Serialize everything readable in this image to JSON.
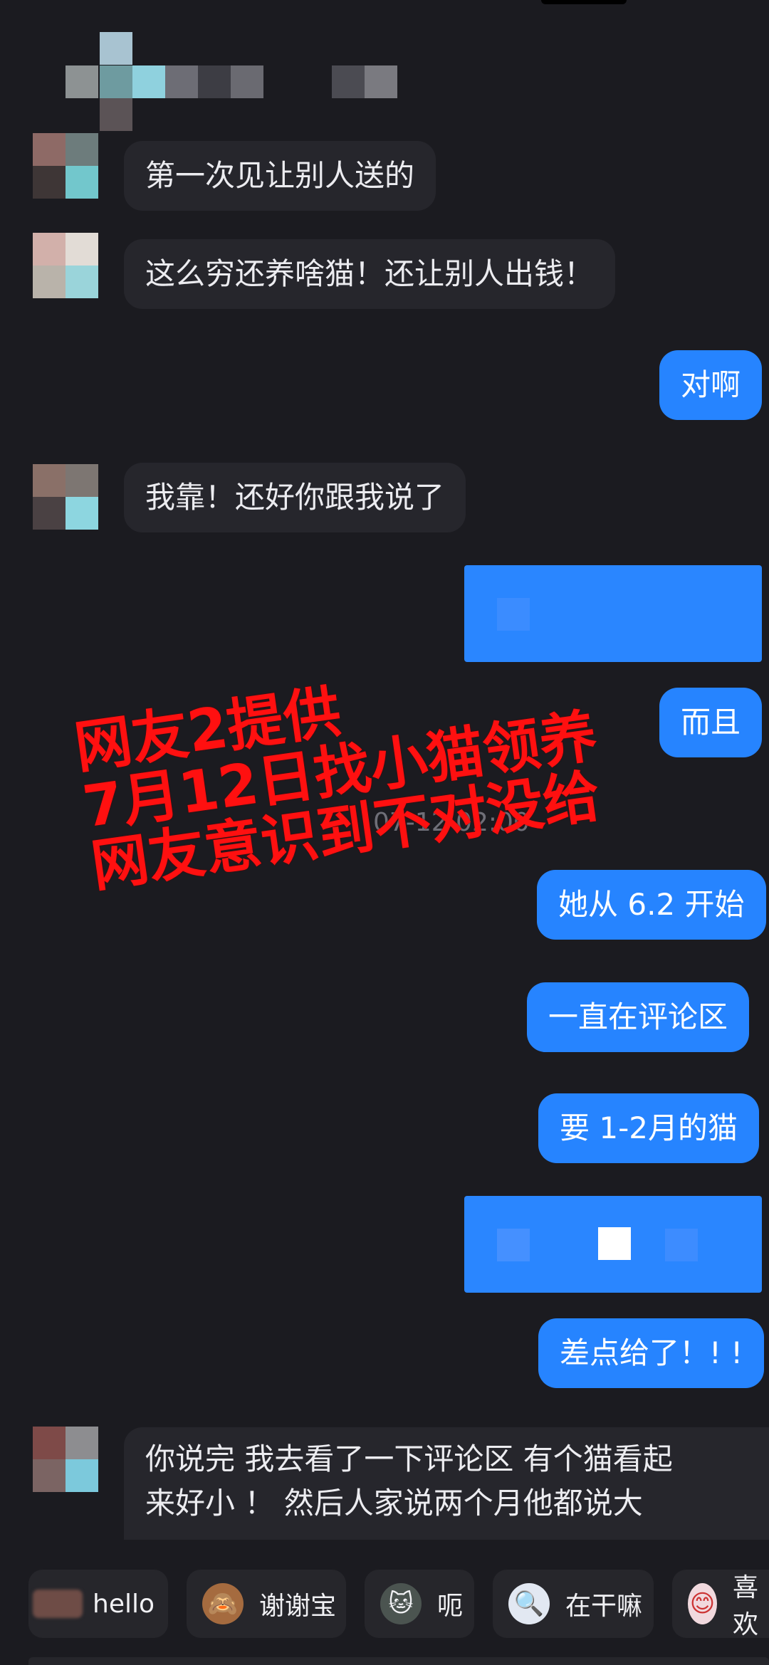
{
  "header": {
    "title_text": ""
  },
  "messages": [
    {
      "side": "in",
      "text": "第一次见让别人送的"
    },
    {
      "side": "in",
      "text": "这么穷还养啥猫！还让别人出钱！"
    },
    {
      "side": "out",
      "text": "对啊"
    },
    {
      "side": "in",
      "text": "我靠！还好你跟我说了"
    },
    {
      "side": "out",
      "text": "而且"
    },
    {
      "side": "out",
      "text": "她从 6.2 开始"
    },
    {
      "side": "out",
      "text": "一直在评论区"
    },
    {
      "side": "out",
      "text": "要 1-2月的猫"
    },
    {
      "side": "out",
      "text": "差点给了！! !"
    },
    {
      "side": "in",
      "line1": "你说完  我去看了一下评论区  有个猫看起",
      "line2": "来好小 ！ 然后人家说两个月他都说大"
    }
  ],
  "timestamp": "07-12 02:00",
  "overlay": {
    "line1": "网友2提供",
    "line2": "7月12日找小猫领养",
    "line3": "网友意识到不对没给",
    "color": "#ff1010"
  },
  "quick_replies": [
    {
      "label": "hello",
      "icon": "avatar-icon"
    },
    {
      "label": "谢谢宝",
      "icon": "monkey-sticker-icon"
    },
    {
      "label": "呃",
      "icon": "cat-sticker-icon"
    },
    {
      "label": "在干嘛",
      "icon": "magnifier-sticker-icon"
    },
    {
      "label": "喜欢",
      "icon": "sticker-icon"
    }
  ],
  "colors": {
    "background": "#1b1b20",
    "incoming": "#26262c",
    "outgoing": "#2684ff"
  }
}
